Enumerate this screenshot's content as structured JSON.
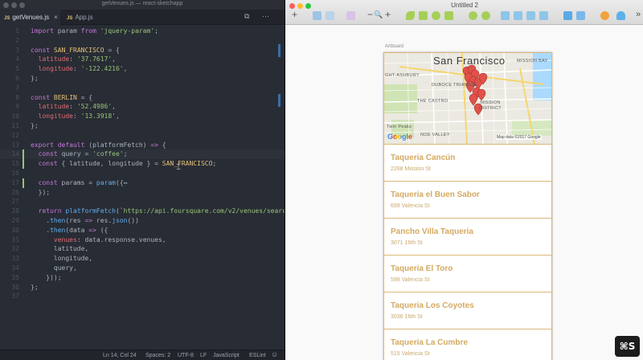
{
  "editor": {
    "window_title": "getVenues.js — react-sketchapp",
    "tabs": [
      {
        "badge": "JS",
        "label": "getVenues.js",
        "close": "×"
      },
      {
        "badge": "JS",
        "label": "App.js"
      }
    ],
    "actions": {
      "split": "⧉",
      "more": "···"
    },
    "lines": [
      {
        "n": "1",
        "html": "<span class='kw'>import</span> param <span class='kw'>from</span> <span class='str'>'jquery-param'</span>;"
      },
      {
        "n": "2",
        "html": ""
      },
      {
        "n": "3",
        "html": "<span class='kw'>const</span> <span class='cn'>SAN_FRANCISCO</span> = {"
      },
      {
        "n": "4",
        "html": "  <span class='pr'>latitude</span>: <span class='str'>'37.7617'</span>,"
      },
      {
        "n": "5",
        "html": "  <span class='pr'>longitude</span>: <span class='str'>'-122.4216'</span>,"
      },
      {
        "n": "6",
        "html": "};"
      },
      {
        "n": "7",
        "html": ""
      },
      {
        "n": "8",
        "html": "<span class='kw'>const</span> <span class='cn'>BERLIN</span> = {"
      },
      {
        "n": "9",
        "html": "  <span class='pr'>latitude</span>: <span class='str'>'52.4986'</span>,"
      },
      {
        "n": "10",
        "html": "  <span class='pr'>longitude</span>: <span class='str'>'13.3918'</span>,"
      },
      {
        "n": "11",
        "html": "};"
      },
      {
        "n": "12",
        "html": ""
      },
      {
        "n": "13",
        "html": "<span class='kw'>export default</span> (platformFetch) <span class='kw'>=&gt;</span> {"
      },
      {
        "n": "14",
        "html": "  <span class='kw'>const</span> query = <span class='str'>'coffee'</span>;"
      },
      {
        "n": "15",
        "html": "  <span class='kw'>const</span> { latitude, longitude } = <span class='cn'>SAN_FRANCISCO</span>;"
      },
      {
        "n": "16",
        "html": ""
      },
      {
        "n": "17",
        "html": "  <span class='kw'>const</span> params = <span class='fn'>param</span>({↔"
      },
      {
        "n": "26",
        "html": "  });"
      },
      {
        "n": "27",
        "html": ""
      },
      {
        "n": "28",
        "html": "  <span class='kw'>return</span> <span class='fn'>platformFetch</span>(<span class='str'>`https://api.foursquare.com/v2/venues/search</span>"
      },
      {
        "n": "29",
        "html": "    .<span class='fn'>then</span>(res <span class='kw'>=&gt;</span> res.<span class='fn'>json</span>())"
      },
      {
        "n": "30",
        "html": "    .<span class='fn'>then</span>(data <span class='kw'>=&gt;</span> ({"
      },
      {
        "n": "31",
        "html": "      <span class='pr'>venues</span>: data.response.venues,"
      },
      {
        "n": "32",
        "html": "      latitude,"
      },
      {
        "n": "33",
        "html": "      longitude,"
      },
      {
        "n": "34",
        "html": "      query,"
      },
      {
        "n": "35",
        "html": "    }));"
      },
      {
        "n": "36",
        "html": "};"
      },
      {
        "n": "37",
        "html": ""
      }
    ],
    "status": {
      "position": "Ln 14, Col 24",
      "spaces": "Spaces: 2",
      "encoding": "UTF-8",
      "eol": "LF",
      "language": "JavaScript",
      "linter": "ESLint",
      "smiley": "☺"
    }
  },
  "sketch": {
    "window_title": "Untitled 2",
    "toolbar": {
      "insert": "+",
      "zoom_out": "−",
      "zoom_glyph": "🔍",
      "zoom_in": "+",
      "overflow": "»"
    },
    "artboard_label": "Artboard",
    "map": {
      "title": "San Francisco",
      "labels": [
        "MISSION BAY",
        "GHT-ASHBURY",
        "DUBOCE TRIANGLE",
        "THE CASTRO",
        "MISSION DISTRICT",
        "Twin Peaks",
        "NOE VALLEY"
      ],
      "google": "Google",
      "attribution": "Map data ©2017 Google",
      "pin_count": 12
    },
    "venues": [
      {
        "name": "Taqueria Cancún",
        "address": "2288 Mission St"
      },
      {
        "name": "Taqueria el Buen Sabor",
        "address": "699 Valencia St"
      },
      {
        "name": "Pancho Villa Taqueria",
        "address": "3071 16th St"
      },
      {
        "name": "Taqueria El Toro",
        "address": "598 Valencia St"
      },
      {
        "name": "Taqueria Los Coyotes",
        "address": "3036 16th St"
      },
      {
        "name": "Taqueria La Cumbre",
        "address": "515 Valencia St"
      }
    ]
  },
  "overlay": {
    "shortcut": "⌘S"
  },
  "colors": {
    "venue_text": "#d4aa62",
    "pin": "#e0524a",
    "editor_bg": "#282c34"
  }
}
